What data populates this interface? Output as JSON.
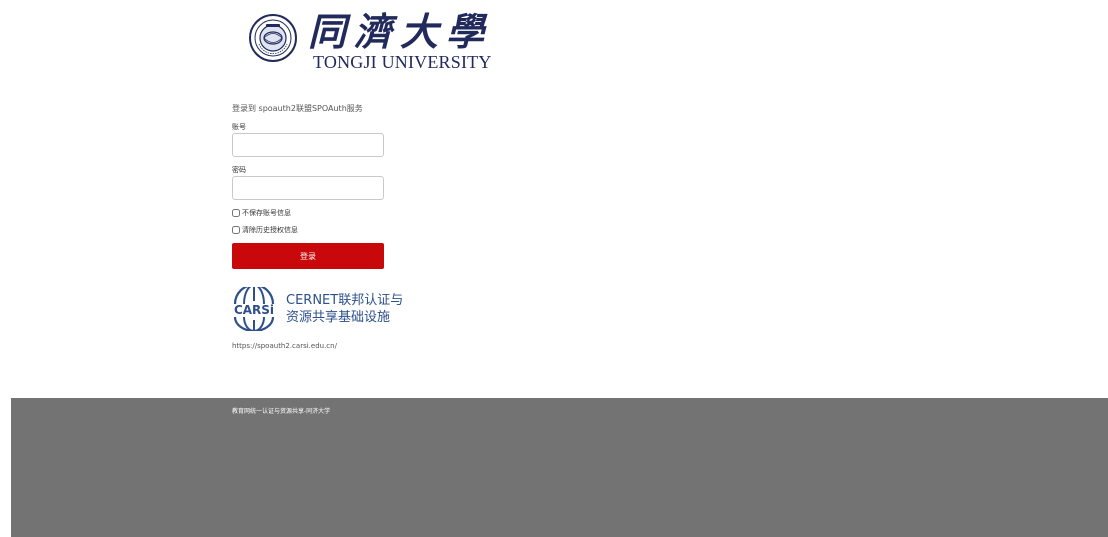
{
  "logo": {
    "cn_text": "同濟大學",
    "en_text": "TONGJI UNIVERSITY",
    "seal_icon": "tongji-seal-icon",
    "color": "#222a5c"
  },
  "form": {
    "title": "登录到 spoauth2联盟SPOAuth服务",
    "account_label": "账号",
    "account_value": "",
    "password_label": "密码",
    "password_value": "",
    "dont_save_label": "不保存账号信息",
    "dont_save_checked": false,
    "clear_history_label": "清除历史授权信息",
    "clear_history_checked": false,
    "login_label": "登录",
    "login_color": "#c8080a"
  },
  "carsi": {
    "logo_text": "CARSi",
    "line1": "CERNET联邦认证与",
    "line2": "资源共享基础设施",
    "url": "https://spoauth2.carsi.edu.cn/",
    "color": "#2d4f8c"
  },
  "footer": {
    "text": "教育网统一认证与资源共享-同济大学",
    "background": "#737373"
  }
}
